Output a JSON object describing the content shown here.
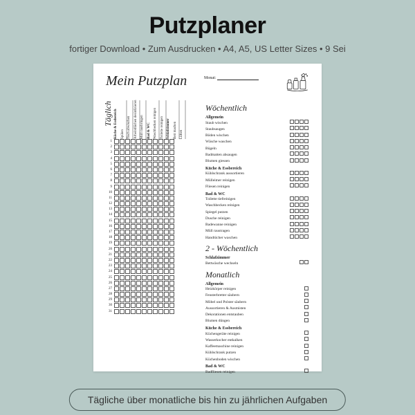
{
  "header": {
    "title": "Putzplaner"
  },
  "subheader": "fortiger Download  •  Zum Ausdrucken  •  A4, A5, US Letter Sizes  •  9 Sei",
  "page": {
    "title": "Mein Putzplan",
    "month_label": "Monat:",
    "daily_heading": "Täglich",
    "daily_columns": [
      {
        "label": "Küche & Essbereich",
        "group": true
      },
      {
        "label": "Spülen",
        "group": false
      },
      {
        "label": "Tisch abwischen",
        "group": false
      },
      {
        "label": "Arbeitsflächen desinfizieren",
        "group": false
      },
      {
        "label": "Müll rausbringen",
        "group": false
      },
      {
        "label": "Bad & WC",
        "group": true
      },
      {
        "label": "Waschbecken reinigen",
        "group": false
      },
      {
        "label": "Toilette reinigen",
        "group": false
      },
      {
        "label": "Schlafzimmer",
        "group": true
      },
      {
        "label": "Bett machen",
        "group": false
      },
      {
        "label": "Lüften",
        "group": false
      }
    ],
    "days": 31,
    "sections": [
      {
        "heading": "Wöchentlich",
        "boxes": 4,
        "groups": [
          {
            "title": "Allgemein",
            "tasks": [
              "Staub wischen",
              "Staubsaugen",
              "Böden wischen",
              "Wäsche waschen",
              "Bügeln",
              "Badmatten absaugen",
              "Blumen giessen"
            ]
          },
          {
            "title": "Küche & Essbereich",
            "tasks": [
              "Kühlschrank aussortieren",
              "Mülleimer reinigen",
              "Fliesen reinigen"
            ]
          },
          {
            "title": "Bad & WC",
            "tasks": [
              "Toilette tiefreinigen",
              "Waschbecken reinigen",
              "Spiegel putzen",
              "Dusche reinigen",
              "Badewanne reinigen",
              "Müll raustragen",
              "Handtücher waschen"
            ]
          }
        ]
      },
      {
        "heading": "2 - Wöchentlich",
        "boxes": 2,
        "groups": [
          {
            "title": "Schlafzimmer",
            "tasks": [
              "Bettwäsche wechseln"
            ]
          }
        ]
      },
      {
        "heading": "Monatlich",
        "boxes": 1,
        "groups": [
          {
            "title": "Allgemein",
            "tasks": [
              "Heizkörper reinigen",
              "Fensterbretter säubern",
              "Möbel und Polster säubern",
              "Aussortieren & Ausmisten",
              "Dekorationen entstauben",
              "Blumen düngen"
            ]
          },
          {
            "title": "Küche & Essbereich",
            "tasks": [
              "Küchengeräte reinigen",
              "Wasserkocher entkalken",
              "Kaffeemaschine reinigen",
              "Kühlschrank putzen",
              "Küchenboden wischen"
            ]
          },
          {
            "title": "Bad & WC",
            "tasks": [
              "Badfliesen reinigen"
            ]
          }
        ]
      }
    ]
  },
  "footer": "Tägliche über monatliche bis hin zu jährlichen Aufgaben"
}
